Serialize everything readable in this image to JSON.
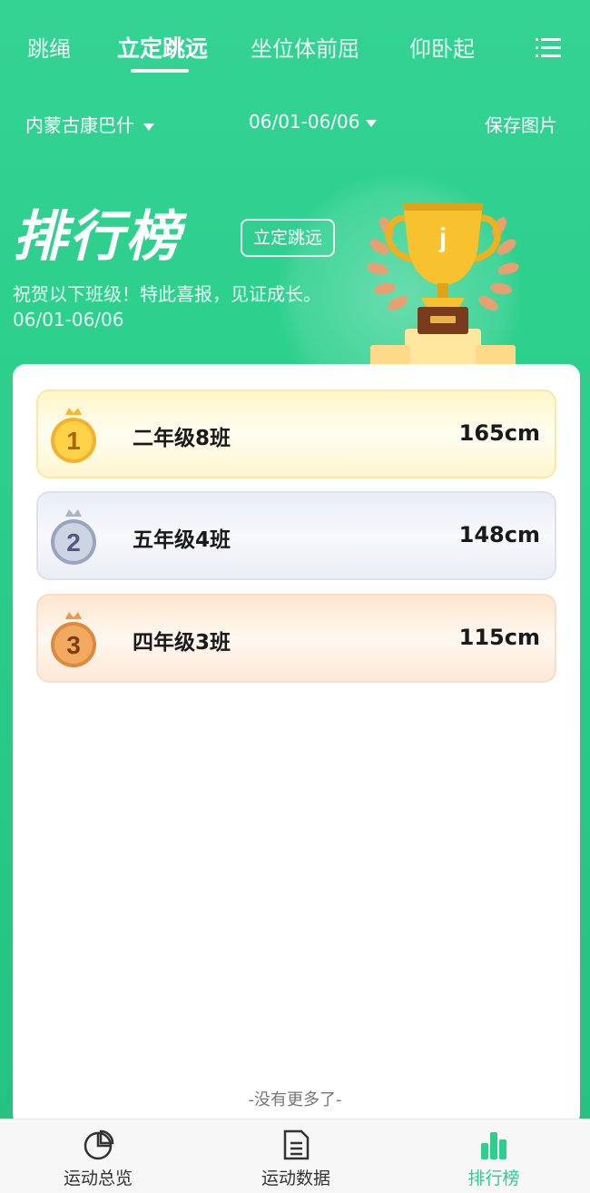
{
  "tabs": [
    {
      "label": "跳绳",
      "active": false
    },
    {
      "label": "立定跳远",
      "active": true
    },
    {
      "label": "坐位体前屈",
      "active": false
    },
    {
      "label": "仰卧起",
      "active": false
    }
  ],
  "menu_icon": "list-menu-icon",
  "filters": {
    "region": "内蒙古康巴什",
    "date_range": "06/01-06/06",
    "save": "保存图片"
  },
  "banner": {
    "title": "排行榜",
    "tag": "立定跳远",
    "subtitle": "祝贺以下班级！特此喜报，见证成长。",
    "date": "06/01-06/06",
    "trophy_letter": "j"
  },
  "rankings": [
    {
      "rank": "1",
      "class": "二年级8班",
      "score": "165cm",
      "medal": "gold"
    },
    {
      "rank": "2",
      "class": "五年级4班",
      "score": "148cm",
      "medal": "silver"
    },
    {
      "rank": "3",
      "class": "四年级3班",
      "score": "115cm",
      "medal": "bronze"
    }
  ],
  "no_more": "-没有更多了-",
  "bottom_nav": [
    {
      "label": "运动总览",
      "icon": "pie-chart-icon",
      "active": false
    },
    {
      "label": "运动数据",
      "icon": "document-icon",
      "active": false
    },
    {
      "label": "排行榜",
      "icon": "bar-chart-icon",
      "active": true
    }
  ],
  "colors": {
    "primary_green": "#2ccf8c",
    "gold": "#f5c13a",
    "silver": "#a7b0c7",
    "bronze": "#e6944a"
  }
}
